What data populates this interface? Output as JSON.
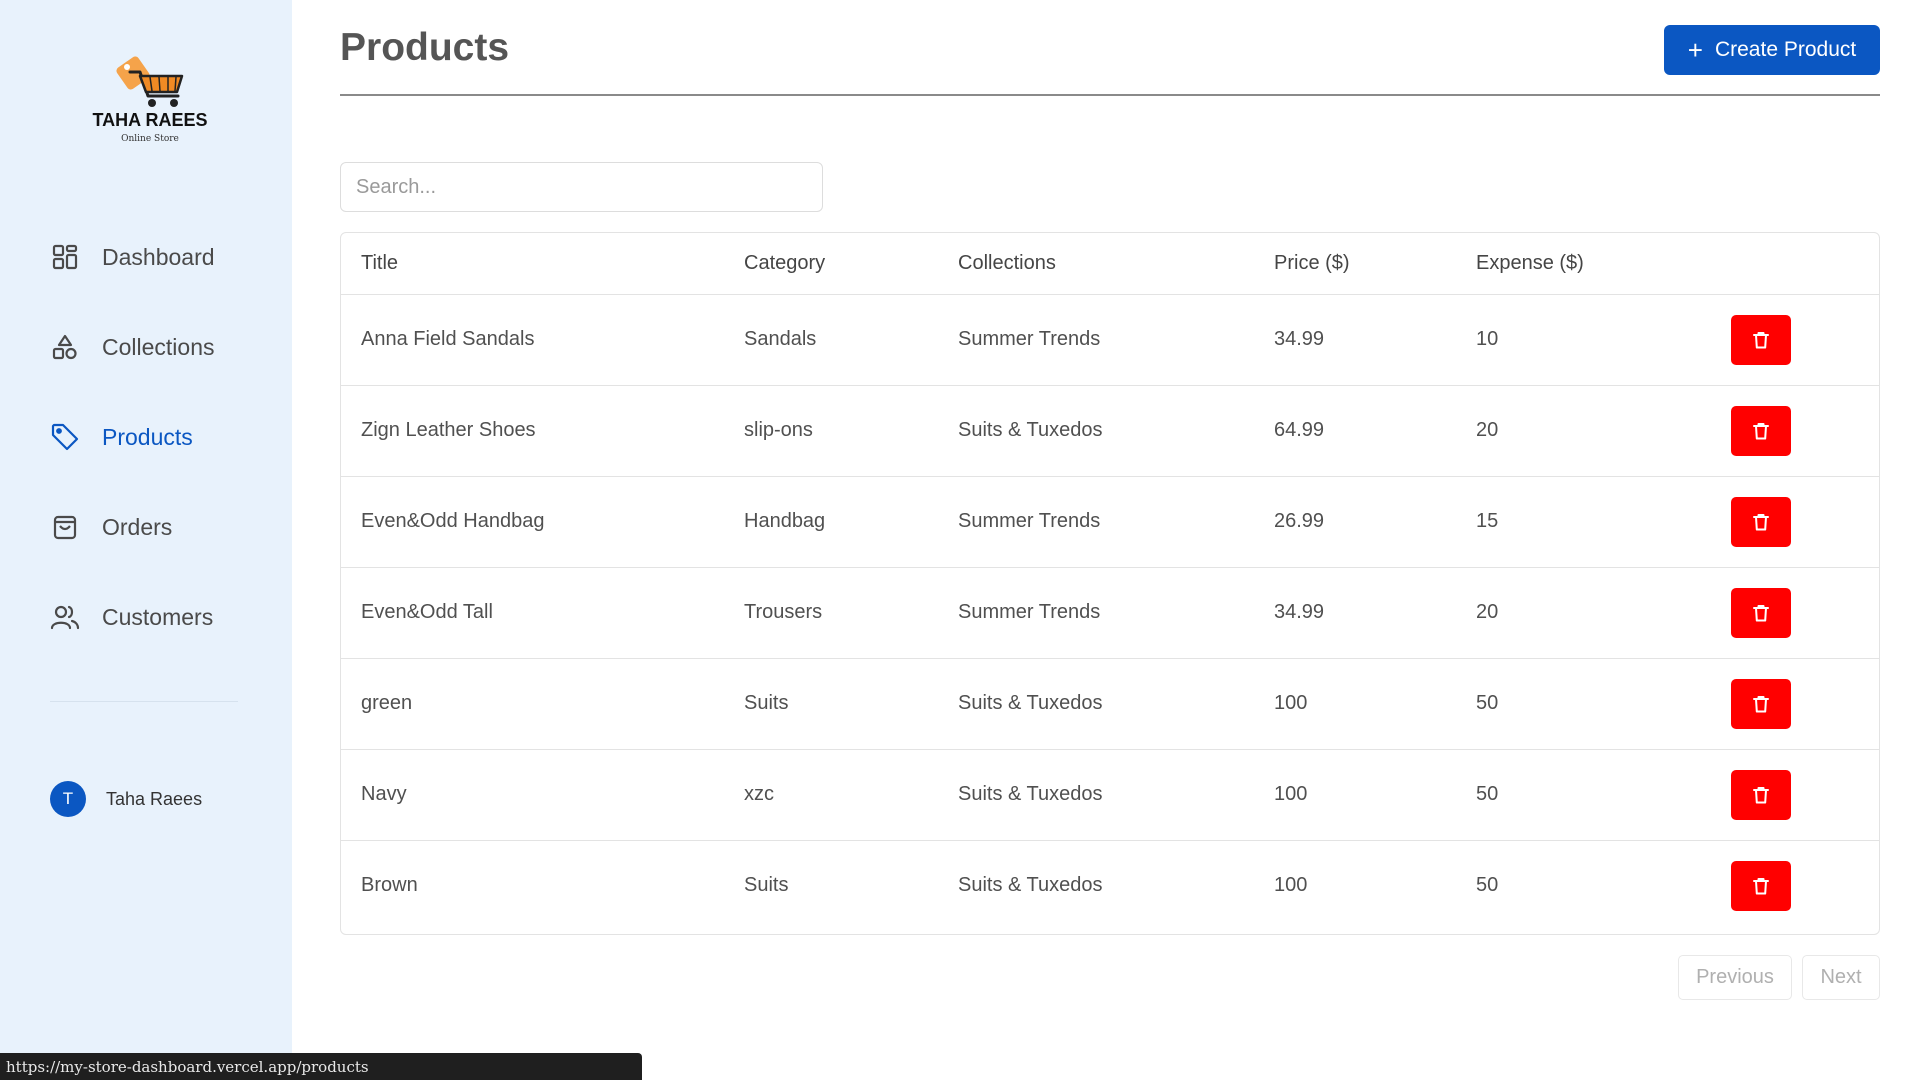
{
  "brand": {
    "title": "TAHA RAEES",
    "subtitle": "Online Store",
    "colors": {
      "cart": "#f08a24",
      "tag": "#f5a34a",
      "text": "#111111"
    }
  },
  "sidebar": {
    "items": [
      {
        "label": "Dashboard",
        "icon": "dashboard-icon",
        "active": false
      },
      {
        "label": "Collections",
        "icon": "collections-icon",
        "active": false
      },
      {
        "label": "Products",
        "icon": "tag-icon",
        "active": true
      },
      {
        "label": "Orders",
        "icon": "shopping-bag-icon",
        "active": false
      },
      {
        "label": "Customers",
        "icon": "users-icon",
        "active": false
      }
    ],
    "user": {
      "initial": "T",
      "name": "Taha Raees"
    }
  },
  "header": {
    "title": "Products",
    "create_label": "Create Product"
  },
  "search": {
    "placeholder": "Search...",
    "value": ""
  },
  "table": {
    "columns": [
      "Title",
      "Category",
      "Collections",
      "Price ($)",
      "Expense ($)"
    ],
    "rows": [
      {
        "title": "Anna Field Sandals",
        "category": "Sandals",
        "collections": "Summer Trends",
        "price": "34.99",
        "expense": "10"
      },
      {
        "title": "Zign Leather Shoes",
        "category": "slip-ons",
        "collections": "Suits & Tuxedos",
        "price": "64.99",
        "expense": "20"
      },
      {
        "title": "Even&Odd Handbag",
        "category": "Handbag",
        "collections": "Summer Trends",
        "price": "26.99",
        "expense": "15"
      },
      {
        "title": "Even&Odd Tall",
        "category": "Trousers",
        "collections": "Summer Trends",
        "price": "34.99",
        "expense": "20"
      },
      {
        "title": "green",
        "category": "Suits",
        "collections": "Suits & Tuxedos",
        "price": "100",
        "expense": "50"
      },
      {
        "title": "Navy",
        "category": "xzc",
        "collections": "Suits & Tuxedos",
        "price": "100",
        "expense": "50"
      },
      {
        "title": "Brown",
        "category": "Suits",
        "collections": "Suits & Tuxedos",
        "price": "100",
        "expense": "50"
      }
    ],
    "delete_icon": "trash-icon"
  },
  "pagination": {
    "previous_label": "Previous",
    "next_label": "Next"
  },
  "status_bar": {
    "url": "https://my-store-dashboard.vercel.app/products"
  },
  "colors": {
    "accent": "#0b57c2",
    "danger": "#ff0000",
    "sidebar_bg": "#e8f2fc"
  }
}
